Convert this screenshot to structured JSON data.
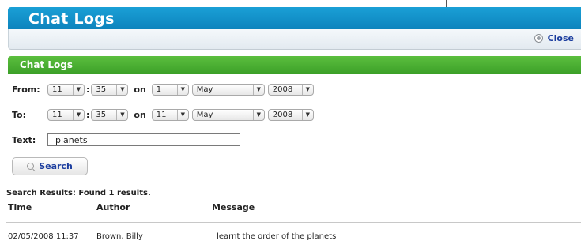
{
  "window": {
    "title": "Chat Logs",
    "close_label": "Close"
  },
  "panel": {
    "title": "Chat Logs"
  },
  "from": {
    "label": "From:",
    "hour": "11",
    "minute": "35",
    "on": "on",
    "day": "1",
    "month": "May",
    "year": "2008"
  },
  "to": {
    "label": "To:",
    "hour": "11",
    "minute": "35",
    "on": "on",
    "day": "11",
    "month": "May",
    "year": "2008"
  },
  "text": {
    "label": "Text:",
    "value": "planets"
  },
  "search_button": "Search",
  "results": {
    "summary": "Search Results: Found 1 results.",
    "columns": [
      "Time",
      "Author",
      "Message"
    ],
    "rows": [
      {
        "time": "02/05/2008 11:37",
        "author": "Brown, Billy",
        "message": "I learnt the order of the planets"
      }
    ]
  },
  "colors": {
    "blue_header": "#1aa0d6",
    "green_header": "#4cb034",
    "link": "#1a3c9e"
  }
}
